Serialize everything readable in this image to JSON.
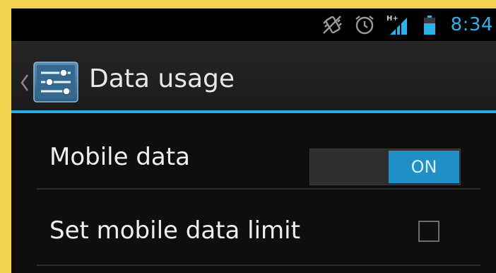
{
  "status_bar": {
    "icons": [
      "vibrate-icon",
      "alarm-icon",
      "hplus-signal-icon",
      "battery-icon"
    ],
    "signal_text": "H+",
    "time": "8:34",
    "time_color": "#2bb3e8"
  },
  "action_bar": {
    "title": "Data usage",
    "accent": "#2ba9e0"
  },
  "settings": {
    "mobile_data": {
      "label": "Mobile data",
      "toggle_state": "ON",
      "enabled": true
    },
    "data_limit": {
      "label": "Set mobile data limit",
      "checked": false
    }
  },
  "colors": {
    "background": "#0e0e0e",
    "frame_outer": "#f2d24f",
    "toggle_on": "#1f8fc5"
  }
}
